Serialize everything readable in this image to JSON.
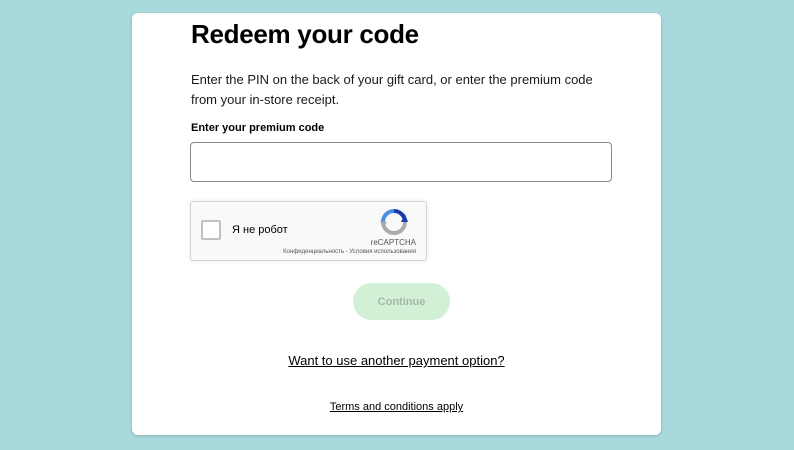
{
  "page": {
    "title": "Redeem your code",
    "description": "Enter the PIN on the back of your gift card, or enter the premium code from your in-store receipt.",
    "code_label": "Enter your premium code",
    "code_value": "",
    "code_placeholder": ""
  },
  "captcha": {
    "checkbox_label": "Я не робот",
    "brand": "reCAPTCHA",
    "privacy": "Конфиденциальность",
    "separator": "-",
    "terms": "Условия использования",
    "logo_icon": "recaptcha-logo-icon"
  },
  "actions": {
    "continue_label": "Continue",
    "alt_payment_link": "Want to use another payment option?",
    "terms_link": "Terms and conditions apply"
  },
  "colors": {
    "background": "#a8d9dc",
    "continue_bg_disabled": "#d2f0d6",
    "continue_text_disabled": "#a4b8a8",
    "recaptcha_blue": "#1c3aa9",
    "recaptcha_light_blue": "#4a90e2",
    "recaptcha_grey": "#abababa"
  }
}
